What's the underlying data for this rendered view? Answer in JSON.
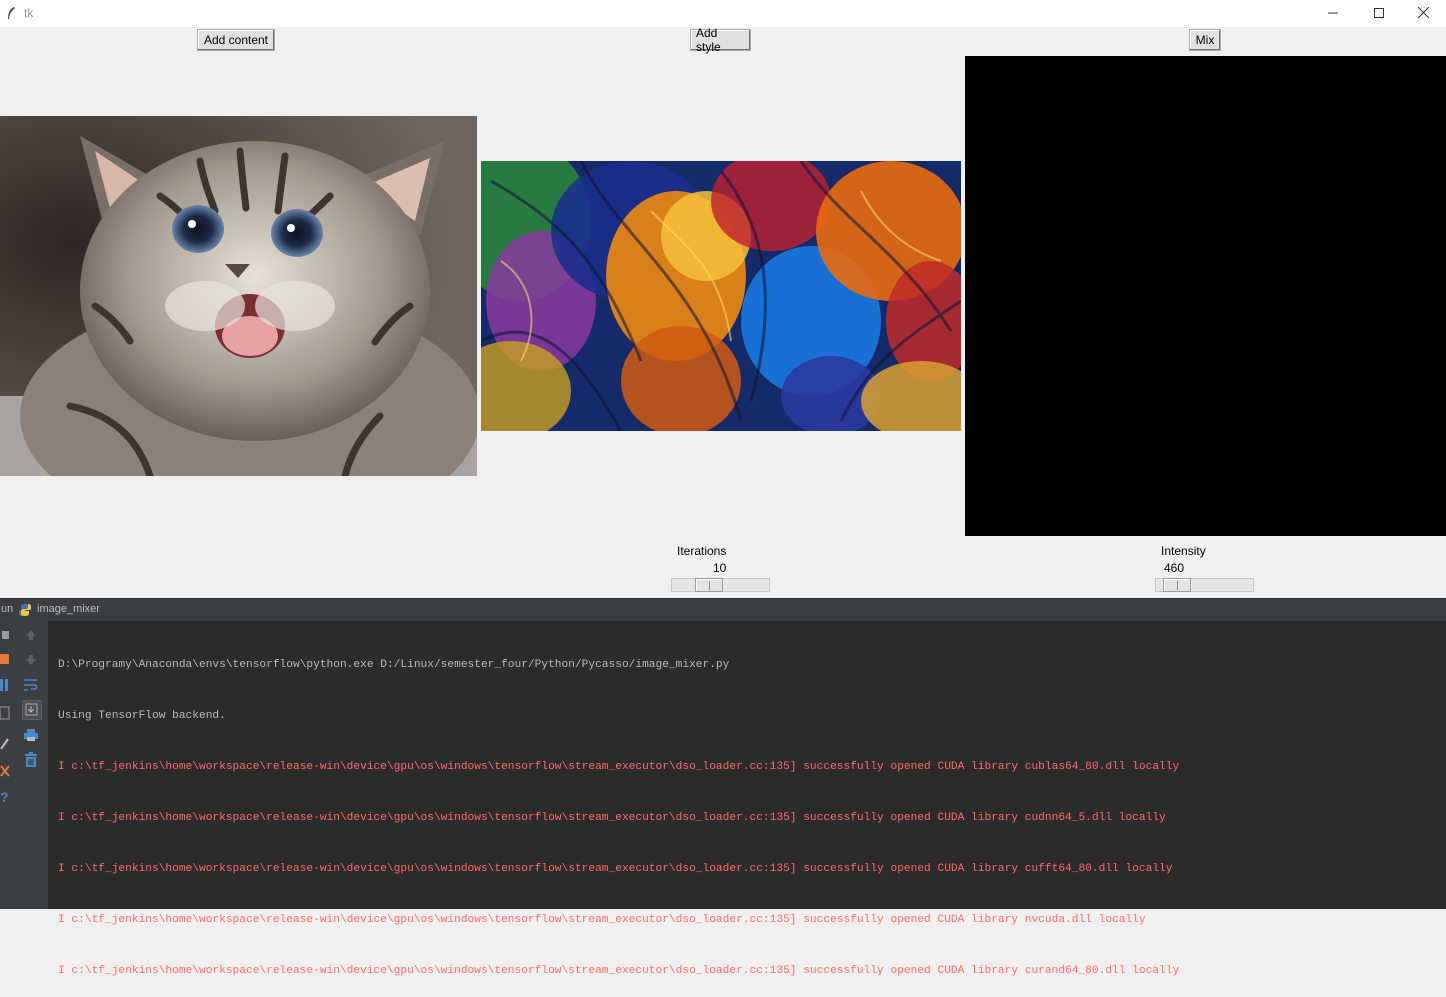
{
  "window": {
    "title": "tk",
    "controls": {
      "minimize": "minimize-icon",
      "maximize": "maximize-icon",
      "close": "close-icon"
    }
  },
  "toolbar": {
    "add_content_label": "Add content",
    "add_style_label": "Add style",
    "mix_label": "Mix"
  },
  "scales": {
    "iterations": {
      "label": "Iterations",
      "value": "10",
      "fraction": 0.33
    },
    "intensity": {
      "label": "Intensity",
      "value": "460",
      "fraction": 0.1
    }
  },
  "run_panel": {
    "tab_label": "un",
    "config_name": "image_mixer",
    "console_lines": [
      "D:\\Programy\\Anaconda\\envs\\tensorflow\\python.exe D:/Linux/semester_four/Python/Pycasso/image_mixer.py",
      "Using TensorFlow backend.",
      "I c:\\tf_jenkins\\home\\workspace\\release-win\\device\\gpu\\os\\windows\\tensorflow\\stream_executor\\dso_loader.cc:135] successfully opened CUDA library cublas64_80.dll locally",
      "I c:\\tf_jenkins\\home\\workspace\\release-win\\device\\gpu\\os\\windows\\tensorflow\\stream_executor\\dso_loader.cc:135] successfully opened CUDA library cudnn64_5.dll locally",
      "I c:\\tf_jenkins\\home\\workspace\\release-win\\device\\gpu\\os\\windows\\tensorflow\\stream_executor\\dso_loader.cc:135] successfully opened CUDA library cufft64_80.dll locally",
      "I c:\\tf_jenkins\\home\\workspace\\release-win\\device\\gpu\\os\\windows\\tensorflow\\stream_executor\\dso_loader.cc:135] successfully opened CUDA library nvcuda.dll locally",
      "I c:\\tf_jenkins\\home\\workspace\\release-win\\device\\gpu\\os\\windows\\tensorflow\\stream_executor\\dso_loader.cc:135] successfully opened CUDA library curand64_80.dll locally"
    ]
  },
  "colors": {
    "window_bg": "#f0f0f0",
    "console_bg": "#2b2b2b",
    "console_text": "#bbbbbb",
    "ide_panel": "#3c3f41",
    "result_bg": "#000000"
  }
}
